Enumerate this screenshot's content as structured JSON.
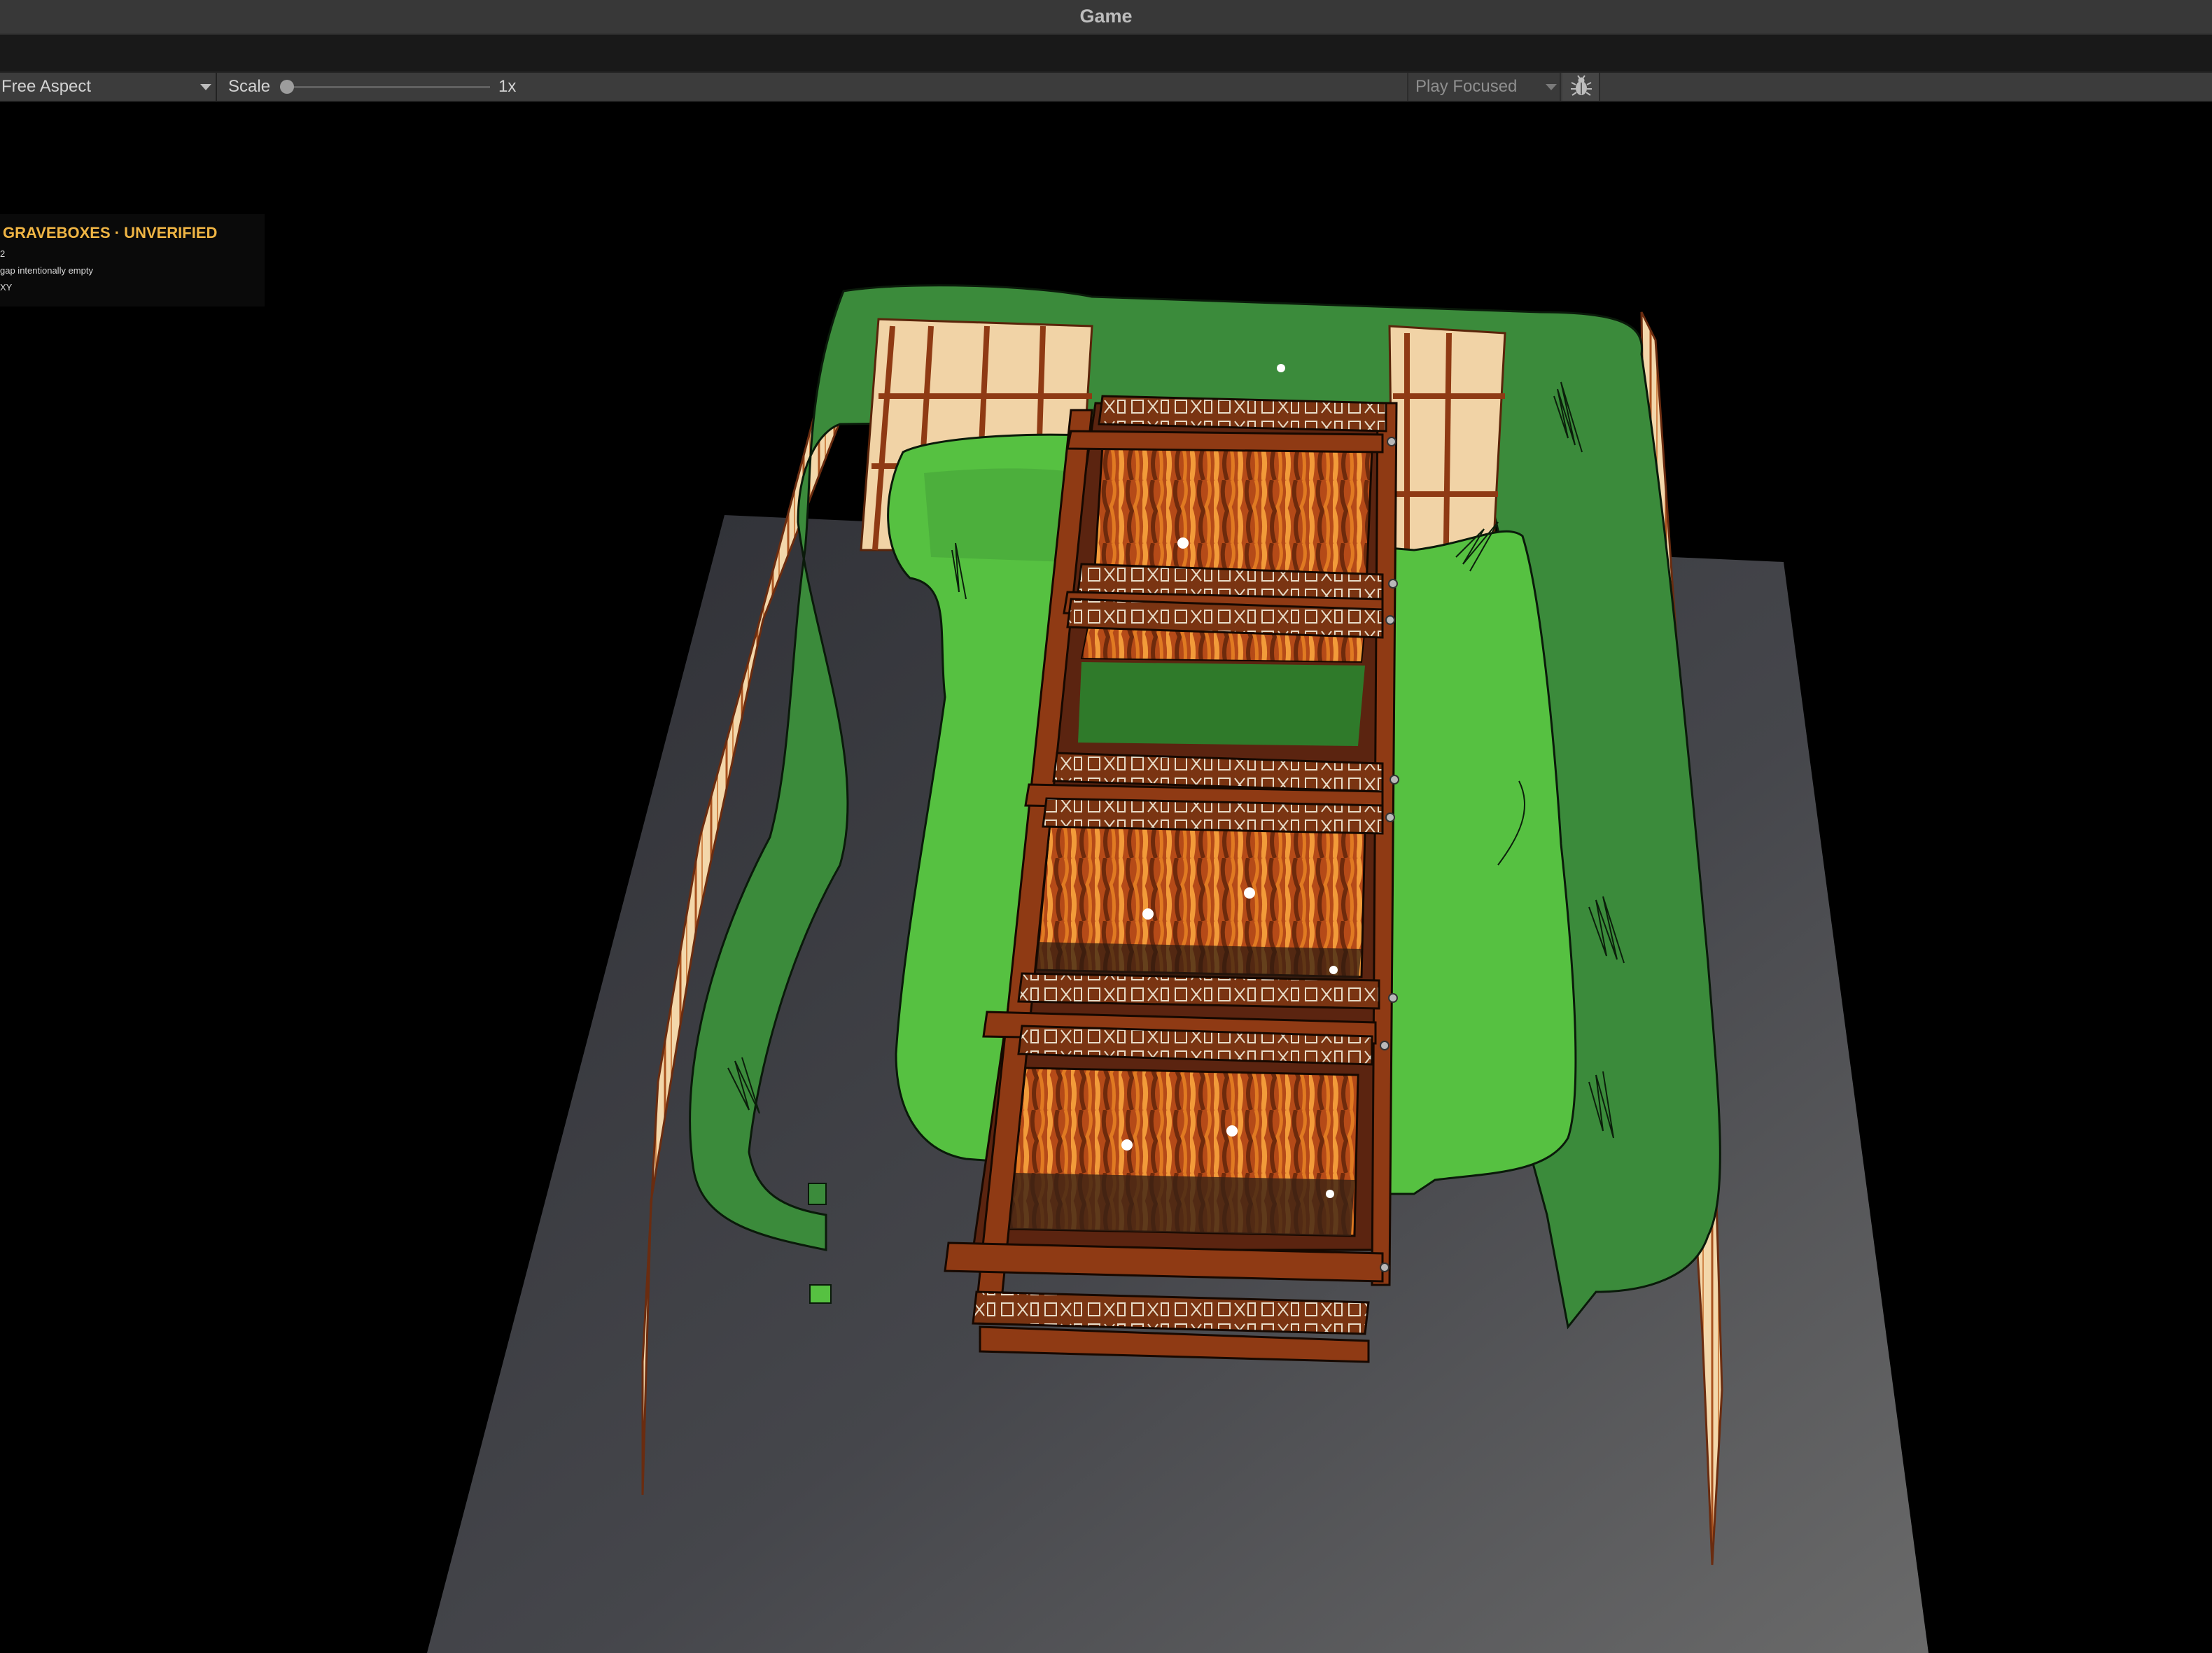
{
  "window": {
    "title": "Game"
  },
  "toolbar": {
    "aspect_label": "Free Aspect",
    "scale_label": "Scale",
    "scale_value": "1x",
    "scale_fraction": 0.0,
    "play_mode_label": "Play Focused",
    "debug_icon": "bug-icon"
  },
  "debug_overlay": {
    "title": "GRAVEBOXES · UNVERIFIED",
    "lines": [
      "2",
      "gap intentionally empty",
      "XY"
    ],
    "title_color": "#f0b544"
  },
  "scene": {
    "description_colors": {
      "floor": "#4a4a4e",
      "grass_light": "#55bf3f",
      "grass_dark": "#3a8a3a",
      "wood": "#8f3a14",
      "wall": "#f3d7aa"
    }
  }
}
